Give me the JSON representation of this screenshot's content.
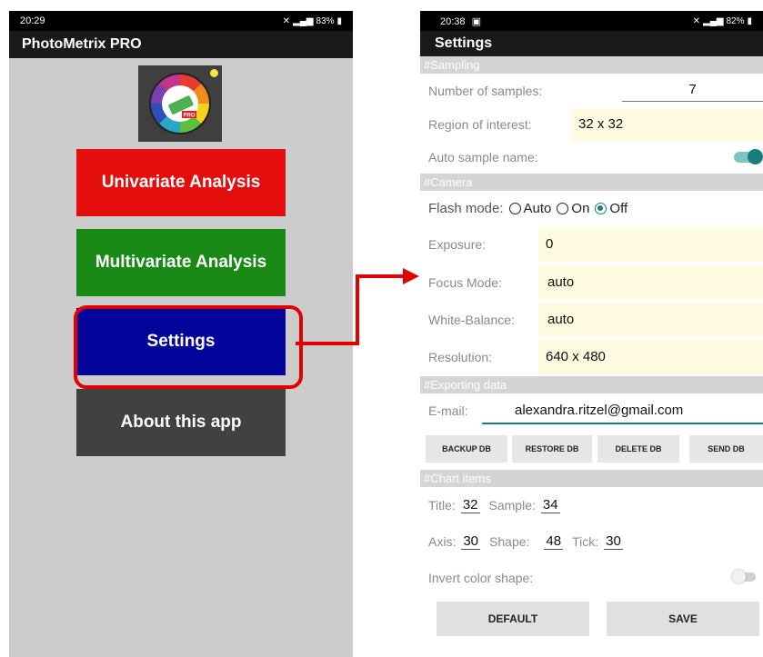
{
  "left_phone": {
    "status": {
      "time": "20:29",
      "battery": "83%"
    },
    "app_title": "PhotoMetrix PRO",
    "logo_text": "PRO",
    "buttons": {
      "univariate": "Univariate Analysis",
      "multivariate": "Multivariate Analysis",
      "settings": "Settings",
      "about": "About this app"
    }
  },
  "right_phone": {
    "status": {
      "time": "20:38",
      "battery": "82%"
    },
    "title": "Settings",
    "sampling": {
      "header": "#Sampling",
      "num_samples_label": "Number of samples:",
      "num_samples_value": "7",
      "roi_label": "Region of interest:",
      "roi_value": "32 x 32",
      "auto_name_label": "Auto sample name:",
      "auto_name_on": true
    },
    "camera": {
      "header": "#Camera",
      "flash_label": "Flash mode:",
      "flash_options": [
        "Auto",
        "On",
        "Off"
      ],
      "flash_selected": "Off",
      "exposure_label": "Exposure:",
      "exposure_value": "0",
      "focus_label": "Focus Mode:",
      "focus_value": "auto",
      "wb_label": "White-Balance:",
      "wb_value": "auto",
      "resolution_label": "Resolution:",
      "resolution_value": "640 x 480"
    },
    "export": {
      "header": "#Exporting data",
      "email_label": "E-mail:",
      "email_value": "alexandra.ritzel@gmail.com",
      "buttons": [
        "BACKUP DB",
        "RESTORE DB",
        "DELETE DB",
        "SEND DB"
      ]
    },
    "chart": {
      "header": "#Chart items",
      "title_label": "Title:",
      "title_value": "32",
      "sample_label": "Sample:",
      "sample_value": "34",
      "axis_label": "Axis:",
      "axis_value": "30",
      "shape_label": "Shape:",
      "shape_value": "48",
      "tick_label": "Tick:",
      "tick_value": "30",
      "invert_label": "Invert color shape:",
      "invert_on": false
    },
    "footer": {
      "default_label": "DEFAULT",
      "save_label": "SAVE"
    }
  },
  "colors": {
    "univariate": "#e40e0e",
    "multivariate": "#1a8a16",
    "settings": "#04039a",
    "about": "#414141",
    "highlight": "#e00000",
    "accent": "#1a7d7d"
  }
}
